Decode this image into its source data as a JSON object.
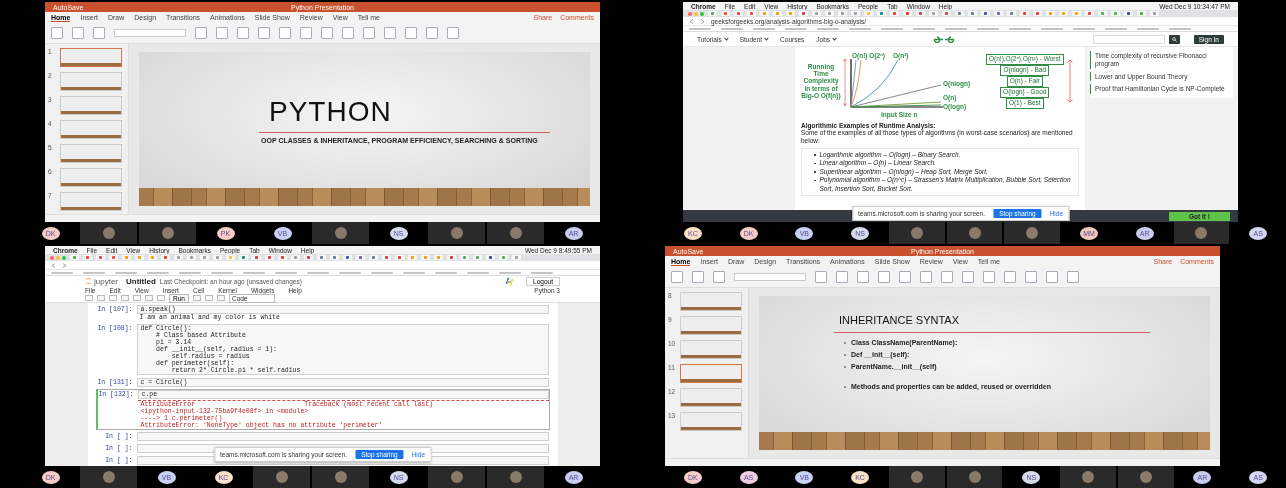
{
  "quadrants": [
    {
      "kind": "powerpoint",
      "autosave": "AutoSave",
      "window_title": "Python Presentation",
      "share": "Share",
      "comments": "Comments",
      "ribbon_tabs": [
        {
          "label": "Home",
          "selected": true
        },
        {
          "label": "Insert",
          "selected": false
        },
        {
          "label": "Draw",
          "selected": false
        },
        {
          "label": "Design",
          "selected": false
        },
        {
          "label": "Transitions",
          "selected": false
        },
        {
          "label": "Animations",
          "selected": false
        },
        {
          "label": "Slide Show",
          "selected": false
        },
        {
          "label": "Review",
          "selected": false
        },
        {
          "label": "View",
          "selected": false
        },
        {
          "label": "Tell me",
          "selected": false
        }
      ],
      "thumbnails": [
        {
          "number": "1",
          "selected": true
        },
        {
          "number": "2",
          "selected": false
        },
        {
          "number": "3",
          "selected": false
        },
        {
          "number": "4",
          "selected": false
        },
        {
          "number": "5",
          "selected": false
        },
        {
          "number": "6",
          "selected": false
        },
        {
          "number": "7",
          "selected": false
        }
      ],
      "slide": {
        "kind": "title",
        "title": "PYTHON",
        "subtitle": "OOP CLASSES & INHERITANCE, PROGRAM EFFICIENCY, SEARCHING & SORTING"
      },
      "participants": [
        {
          "kind": "initials",
          "initials": "DK",
          "color": "#f6cdc6"
        },
        {
          "kind": "photo"
        },
        {
          "kind": "photo"
        },
        {
          "kind": "initials",
          "initials": "PK",
          "color": "#f6cdc6"
        },
        {
          "kind": "initials",
          "initials": "VB",
          "color": "#c8d2f2"
        },
        {
          "kind": "photo"
        },
        {
          "kind": "initials",
          "initials": "NS",
          "color": "#d5dbea"
        },
        {
          "kind": "photo"
        },
        {
          "kind": "photo"
        },
        {
          "kind": "initials",
          "initials": "AR",
          "color": "#cbcdee"
        }
      ]
    },
    {
      "kind": "browser",
      "menu": [
        "Chrome",
        "File",
        "Edit",
        "View",
        "History",
        "Bookmarks",
        "People",
        "Tab",
        "Window",
        "Help"
      ],
      "clock": "Wed Dec 9  10:34:47 PM",
      "url": "geeksforgeeks.org/analysis-algorithms-big-o-analysis/",
      "site_nav": [
        "Tutorials",
        "Student",
        "Courses",
        "Jobs"
      ],
      "sign_in": "Sign In",
      "chart_axis_label": "Running Time Complexity in terms of Big-O O(f(n))",
      "chart_x_label": "Input Size n",
      "curve_labels": [
        "O(n!) O(2ⁿ)",
        "O(n²)",
        "O(nlogn)",
        "O(n)",
        "O(logn)"
      ],
      "legend": [
        "O(n!),O(2ⁿ),O(n²) - Worst",
        "O(nlogn) - Bad",
        "O(n) - Fair",
        "O(logn) - Good",
        "O(1) - Best"
      ],
      "heading": "Algorithmic Examples of Runtime Analysis:",
      "intro": "Some of the examples of all those types of algorithms (in worst-case scenarios) are mentioned below:",
      "bullets": [
        "Logarithmic algorithm – O(logn) – Binary Search.",
        "Linear algorithm – O(n) – Linear Search.",
        "Superlinear algorithm – O(nlogn) – Heap Sort, Merge Sort.",
        "Polynomial algorithm – O(n^c) – Strassen's Matrix Multiplication, Bubble Sort, Selection Sort, Insertion Sort, Bucket Sort."
      ],
      "sidebar_links": [
        "Time complexity of recursive Fibonacci program",
        "Lower and Upper Bound Theory",
        "Proof that Hamiltonian Cycle is NP-Complete"
      ],
      "cookie_button": "Got It !",
      "sharing_bar": {
        "message": "teams.microsoft.com is sharing your screen.",
        "stop": "Stop sharing",
        "hide": "Hide"
      },
      "participants": [
        {
          "kind": "initials",
          "initials": "KC",
          "color": "#fbe1c8"
        },
        {
          "kind": "initials",
          "initials": "DK",
          "color": "#f6cdc6"
        },
        {
          "kind": "initials",
          "initials": "VB",
          "color": "#c8d2f2"
        },
        {
          "kind": "initials",
          "initials": "NS",
          "color": "#d5dbea"
        },
        {
          "kind": "photo"
        },
        {
          "kind": "photo"
        },
        {
          "kind": "photo"
        },
        {
          "kind": "initials",
          "initials": "MM",
          "color": "#f6c8bb"
        },
        {
          "kind": "initials",
          "initials": "AR",
          "color": "#cbcdee"
        },
        {
          "kind": "photo"
        },
        {
          "kind": "initials",
          "initials": "AS",
          "color": "#d2d7ef"
        }
      ]
    },
    {
      "kind": "notebook",
      "menu": [
        "Chrome",
        "File",
        "Edit",
        "View",
        "History",
        "Bookmarks",
        "People",
        "Tab",
        "Window",
        "Help"
      ],
      "clock": "Wed Dec 9  8:49:55 PM",
      "logo": "jupyter",
      "notebook_name": "Untitled",
      "checkpoint": "Last Checkpoint: an hour ago (unsaved changes)",
      "logout": "Logout",
      "nb_menu": [
        "File",
        "Edit",
        "View",
        "Insert",
        "Cell",
        "Kernel",
        "Widgets",
        "Help"
      ],
      "kernel": "Python 3",
      "run": "Run",
      "cell_type": "Code",
      "cells": [
        {
          "prompt": "In [107]:",
          "selected": false,
          "code": [
            "a.speak()"
          ],
          "output": {
            "error": false,
            "lines": [
              "I am an animal and my color is white"
            ]
          }
        },
        {
          "prompt": "In [108]:",
          "selected": false,
          "code": [
            "def Circle():",
            "    # Class based Attribute",
            "    pi = 3.14",
            "    def __init__(self, radius = 1):",
            "        self.radius = radius",
            "    def perimeter(self):",
            "        return 2* Circle.pi * self.radius"
          ]
        },
        {
          "prompt": "In [131]:",
          "selected": false,
          "code": [
            "c = Circle()"
          ]
        },
        {
          "prompt": "In [132]:",
          "selected": true,
          "code": [
            "c.pe"
          ],
          "output": {
            "error": true,
            "lines": [
              "AttributeError                            Traceback (most recent call last)",
              "<ipython-input-132-75ba9f4e08f> in <module>",
              "----> 1 c.perimeter()",
              "AttributeError: 'NoneType' object has no attribute 'perimeter'"
            ]
          }
        },
        {
          "prompt": "In [ ]:",
          "selected": false
        },
        {
          "prompt": "In [ ]:",
          "selected": false
        },
        {
          "prompt": "In [ ]:",
          "selected": false
        }
      ],
      "sharing_bar": {
        "message": "teams.microsoft.com is sharing your screen.",
        "stop": "Stop sharing",
        "hide": "Hide"
      },
      "participants": [
        {
          "kind": "initials",
          "initials": "DK",
          "color": "#f6cdc6"
        },
        {
          "kind": "photo"
        },
        {
          "kind": "initials",
          "initials": "VB",
          "color": "#c8d2f2"
        },
        {
          "kind": "initials",
          "initials": "KC",
          "color": "#fbe1c8"
        },
        {
          "kind": "photo"
        },
        {
          "kind": "photo"
        },
        {
          "kind": "initials",
          "initials": "NS",
          "color": "#d5dbea"
        },
        {
          "kind": "photo"
        },
        {
          "kind": "photo"
        },
        {
          "kind": "initials",
          "initials": "AR",
          "color": "#cbcdee"
        }
      ]
    },
    {
      "kind": "powerpoint",
      "autosave": "AutoSave",
      "window_title": "Python Presentation",
      "share": "Share",
      "comments": "Comments",
      "ribbon_tabs": [
        {
          "label": "Home",
          "selected": true
        },
        {
          "label": "Insert",
          "selected": false
        },
        {
          "label": "Draw",
          "selected": false
        },
        {
          "label": "Design",
          "selected": false
        },
        {
          "label": "Transitions",
          "selected": false
        },
        {
          "label": "Animations",
          "selected": false
        },
        {
          "label": "Slide Show",
          "selected": false
        },
        {
          "label": "Review",
          "selected": false
        },
        {
          "label": "View",
          "selected": false
        },
        {
          "label": "Tell me",
          "selected": false
        }
      ],
      "thumbnails": [
        {
          "number": "8",
          "selected": false
        },
        {
          "number": "9",
          "selected": false
        },
        {
          "number": "10",
          "selected": false
        },
        {
          "number": "11",
          "selected": true
        },
        {
          "number": "12",
          "selected": false
        },
        {
          "number": "13",
          "selected": false
        }
      ],
      "slide": {
        "kind": "bullets",
        "title": "INHERITANCE SYNTAX",
        "bullets": [
          {
            "text": "Class ClassName(ParentName):",
            "gap_before": false
          },
          {
            "text": "Def __init__(self):",
            "gap_before": false
          },
          {
            "text": "ParentName.__init__(self)",
            "gap_before": false
          },
          {
            "text": "Methods and properties can be added, reused or overridden",
            "gap_before": true
          }
        ]
      },
      "participants": [
        {
          "kind": "initials",
          "initials": "DK",
          "color": "#f6cdc6"
        },
        {
          "kind": "initials",
          "initials": "AS",
          "color": "#f1cde0"
        },
        {
          "kind": "initials",
          "initials": "VB",
          "color": "#c8d2f2"
        },
        {
          "kind": "initials",
          "initials": "KC",
          "color": "#fbe1c8"
        },
        {
          "kind": "photo"
        },
        {
          "kind": "photo"
        },
        {
          "kind": "initials",
          "initials": "NS",
          "color": "#d5dbea"
        },
        {
          "kind": "photo"
        },
        {
          "kind": "photo"
        },
        {
          "kind": "initials",
          "initials": "AR",
          "color": "#cbcdee"
        },
        {
          "kind": "initials",
          "initials": "AS",
          "color": "#d2d7ef"
        }
      ]
    }
  ]
}
